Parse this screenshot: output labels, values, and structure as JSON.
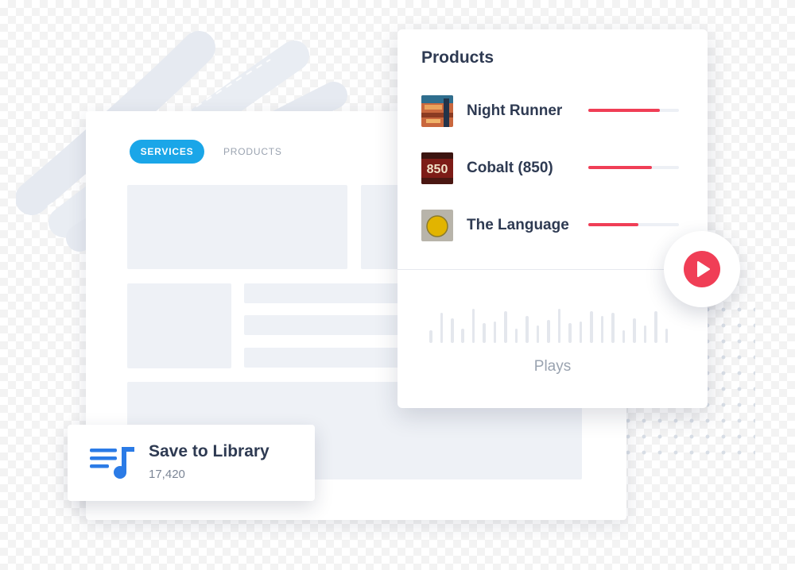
{
  "tabs": {
    "services": "SERVICES",
    "products": "PRODUCTS"
  },
  "products_panel": {
    "title": "Products",
    "items": [
      {
        "name": "Night Runner",
        "progress": 0.79
      },
      {
        "name": "Cobalt (850)",
        "progress": 0.7
      },
      {
        "name": "The Language",
        "progress": 0.55
      }
    ],
    "thumb_text_cobalt": "850",
    "plays_label": "Plays",
    "plays_levels": [
      0.35,
      0.85,
      0.7,
      0.4,
      0.95,
      0.55,
      0.6,
      0.9,
      0.4,
      0.75,
      0.5,
      0.65,
      0.95,
      0.55,
      0.6,
      0.9,
      0.75,
      0.85,
      0.35,
      0.7,
      0.5,
      0.9,
      0.4
    ]
  },
  "play_button": {
    "icon": "play-icon"
  },
  "save_widget": {
    "title": "Save to Library",
    "count": "17,420",
    "icon": "playlist-music-icon"
  },
  "colors": {
    "accent_blue": "#1aa6e8",
    "accent_red": "#f03e56",
    "text_dark": "#2e3a52",
    "muted": "#9aa3b0"
  }
}
